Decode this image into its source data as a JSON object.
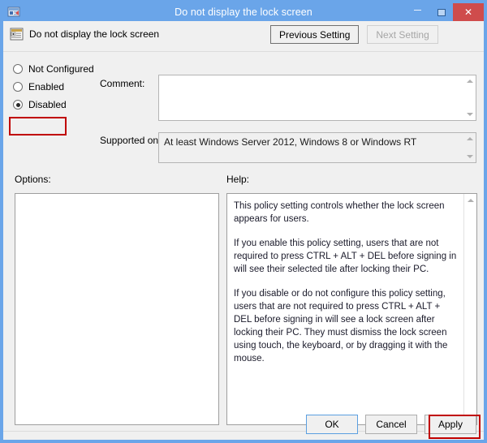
{
  "window": {
    "title": "Do not display the lock screen",
    "icon": "group-policy-editor-icon",
    "controls": {
      "minimize": "minimize-icon",
      "maximize": "maximize-icon",
      "close": "✕"
    }
  },
  "header": {
    "icon": "policy-setting-icon",
    "policy_name": "Do not display the lock screen",
    "previous_setting_label": "Previous Setting",
    "next_setting_label": "Next Setting",
    "next_setting_disabled": true
  },
  "state": {
    "options": [
      {
        "label": "Not Configured",
        "selected": false
      },
      {
        "label": "Enabled",
        "selected": false
      },
      {
        "label": "Disabled",
        "selected": true
      }
    ],
    "selected": "Disabled"
  },
  "comment": {
    "label": "Comment:",
    "value": "",
    "placeholder": ""
  },
  "supported_on": {
    "label": "Supported on:",
    "value": "At least Windows Server 2012, Windows 8 or Windows RT"
  },
  "options_panel": {
    "label": "Options:",
    "content": ""
  },
  "help_panel": {
    "label": "Help:",
    "paragraphs": [
      "This policy setting controls whether the lock screen appears for users.",
      "If you enable this policy setting, users that are not required to press CTRL + ALT + DEL before signing in will see their selected tile after  locking their PC.",
      "If you disable or do not configure this policy setting, users that are not required to press CTRL + ALT + DEL before signing in will see a lock screen after locking their PC. They must dismiss the lock screen using touch, the keyboard, or by dragging it with the mouse."
    ]
  },
  "footer": {
    "ok_label": "OK",
    "cancel_label": "Cancel",
    "apply_label": "Apply"
  },
  "annotations": {
    "disabled_highlight": "red-box-around-disabled-radio",
    "apply_highlight": "red-box-around-apply-button",
    "color": "#c00000"
  },
  "colors": {
    "titlebar": "#6aa5e9",
    "close_button": "#cf4c4c",
    "dialog_background": "#f0f0f0",
    "annotation_red": "#c00000",
    "focus_blue": "#5b9fe0"
  }
}
